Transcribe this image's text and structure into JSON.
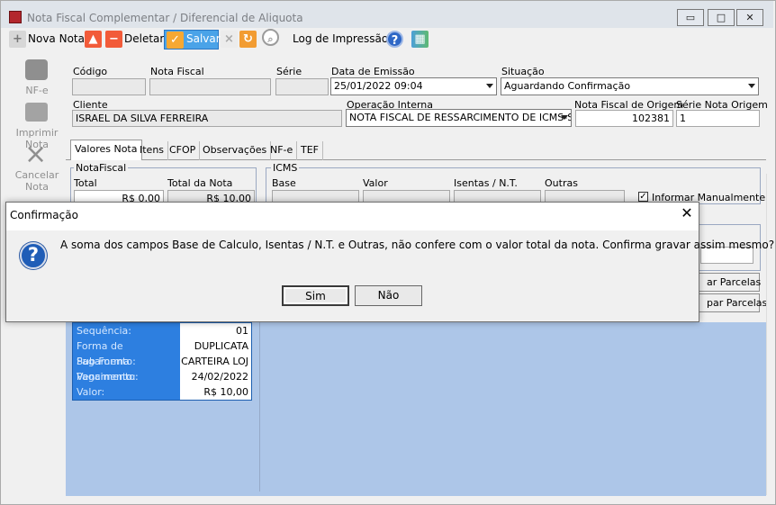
{
  "window": {
    "title": "Nota Fiscal Complementar / Diferencial de Aliquota",
    "controls": {
      "minimize": "▭",
      "maximize": "□",
      "close": "✕"
    }
  },
  "toolbar": {
    "new_label": "Nova Nota",
    "delete_label": "Deletar",
    "save_label": "Salvar",
    "print_log_label": "Log de Impressão"
  },
  "sidebar": {
    "nfe": "NF-e",
    "print_note": "Imprimir Nota",
    "cancel_note_line1": "Cancelar",
    "cancel_note_line2": "Nota"
  },
  "header": {
    "code_label": "Código",
    "invoice_label": "Nota Fiscal",
    "series_label": "Série",
    "issue_date_label": "Data de Emissão",
    "issue_date": "25/01/2022 09:04",
    "status_label": "Situação",
    "status": "Aguardando Confirmação",
    "client_label": "Cliente",
    "client": "ISRAEL DA SILVA FERREIRA",
    "operation_label": "Operação Interna",
    "operation": "NOTA FISCAL DE RESSARCIMENTO DE ICMS-ST",
    "origin_invoice_label": "Nota Fiscal de Origem",
    "origin_invoice": "102381",
    "origin_series_label": "Série Nota Origem",
    "origin_series": "1"
  },
  "tabs": [
    "Valores Nota",
    "Itens",
    "CFOP",
    "Observações",
    "NF-e",
    "TEF"
  ],
  "values": {
    "note_group": "NotaFiscal",
    "total_label": "Total",
    "total": "R$ 0,00",
    "note_total_label": "Total da Nota",
    "note_total": "R$ 10,00",
    "icms_group": "ICMS",
    "base_label": "Base",
    "value_label": "Valor",
    "exempt_label": "Isentas / N.T.",
    "other_label": "Outras",
    "manual_label": "Informar Manualmente"
  },
  "installments": {
    "button_1": "ar Parcelas",
    "button_2": "par Parcelas",
    "sequence_label": "Sequência:",
    "sequence": "01",
    "payment_label": "Forma de Pagamento:",
    "payment": "DUPLICATA",
    "sub_payment_label": "Sub Forma Pagamento:",
    "sub_payment": "CARTEIRA LOJ",
    "due_label": "Vencimento:",
    "due": "24/02/2022",
    "amount_label": "Valor:",
    "amount": "R$ 10,00"
  },
  "dialog": {
    "title": "Confirmação",
    "message": "A soma dos campos Base de Calculo, Isentas / N.T. e Outras, não confere com o valor total da nota. Confirma gravar assim mesmo?",
    "yes": "Sim",
    "no": "Não",
    "close": "✕"
  },
  "colors": {
    "accent": "#2d7fe0",
    "blue_background": "#adc6e8",
    "save_button": "#4aa3e8"
  }
}
